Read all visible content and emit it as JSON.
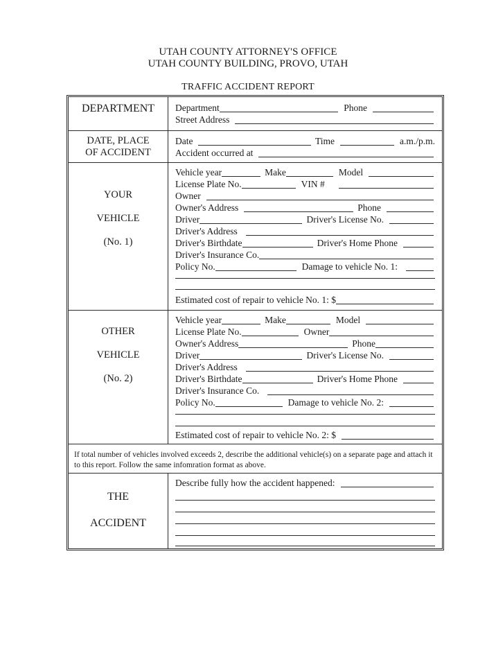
{
  "header": {
    "office": "UTAH COUNTY ATTORNEY'S OFFICE",
    "building": "UTAH COUNTY BUILDING, PROVO, UTAH",
    "form_title": "TRAFFIC ACCIDENT REPORT"
  },
  "department": {
    "label": "DEPARTMENT",
    "department_field": "Department",
    "phone_field": "Phone",
    "street_address_field": "Street Address"
  },
  "date_place": {
    "label_line1": "DATE, PLACE",
    "label_line2": "OF ACCIDENT",
    "date_field": "Date",
    "time_field": "Time",
    "ampm": "a.m./p.m.",
    "occurred_at_field": "Accident occurred at"
  },
  "your_vehicle": {
    "label_line1": "YOUR",
    "label_line2": "VEHICLE",
    "label_line3": "(No. 1)",
    "vehicle_year": "Vehicle year",
    "make": "Make",
    "model": "Model",
    "license_plate": "License Plate No.",
    "vin": "VIN #",
    "owner": "Owner",
    "owners_address": "Owner's Address",
    "phone": "Phone",
    "driver": "Driver",
    "drivers_license": "Driver's License No.",
    "drivers_address": "Driver's Address",
    "drivers_birthdate": "Driver's Birthdate",
    "drivers_home_phone": "Driver's Home Phone",
    "drivers_insurance": "Driver's Insurance Co.",
    "policy_no": "Policy No.",
    "damage": "Damage to vehicle No. 1:",
    "estimated_cost": "Estimated cost of repair to vehicle No. 1: $"
  },
  "other_vehicle": {
    "label_line1": "OTHER",
    "label_line2": "VEHICLE",
    "label_line3": "(No. 2)",
    "vehicle_year": "Vehicle year",
    "make": "Make",
    "model": "Model",
    "license_plate": "License Plate No.",
    "owner": "Owner",
    "owners_address": "Owner's Address",
    "phone": "Phone",
    "driver": "Driver",
    "drivers_license": "Driver's License No.",
    "drivers_address": "Driver's Address",
    "drivers_birthdate": "Driver's Birthdate",
    "drivers_home_phone": "Driver's Home Phone",
    "drivers_insurance": "Driver's Insurance Co.",
    "policy_no": "Policy No.",
    "damage": "Damage to vehicle No. 2:",
    "estimated_cost": "Estimated cost of repair to vehicle No. 2: $"
  },
  "note": {
    "text": "If total number of vehicles involved exceeds 2, describe the additional vehicle(s) on a separate page and attach it to this report.  Follow the same infomration format as above."
  },
  "accident": {
    "label_line1": "THE",
    "label_line2": "ACCIDENT",
    "describe": "Describe fully how the accident happened:"
  }
}
